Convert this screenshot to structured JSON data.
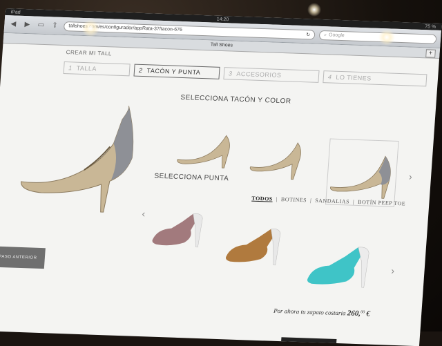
{
  "status": {
    "carrier": "iPad",
    "time": "14:20",
    "battery": "75 %"
  },
  "browser": {
    "url": "tallshoes.com/es/configurador/appRata-37/tacon-676",
    "search_placeholder": "Google",
    "tab_title": "Tall Shoes"
  },
  "page": {
    "crear": "CREAR MI TALL",
    "steps": [
      {
        "num": "1",
        "label": "TALLA"
      },
      {
        "num": "2",
        "label": "TACÓN Y PUNTA"
      },
      {
        "num": "3",
        "label": "ACCESORIOS"
      },
      {
        "num": "4",
        "label": "LO TIENES"
      }
    ],
    "heel_title": "SELECCIONA TACÓN Y COLOR",
    "toe_title": "SELECCIONA PUNTA",
    "filters": [
      "TODOS",
      "BOTINES",
      "SANDALIAS",
      "BOTÍN PEEP TOE"
    ],
    "prev_button": "PASO ANTERIOR",
    "price_text": "Por ahora tu zapato costaría",
    "price_value": "260,",
    "price_cents": "00",
    "currency": "€"
  },
  "colors": {
    "shoe_beige": "#c9b796",
    "shoe_silver": "#8e9096",
    "toe_pink": "#a27a7d",
    "toe_tan": "#b07a3e",
    "toe_turquoise": "#3fc4c7"
  }
}
